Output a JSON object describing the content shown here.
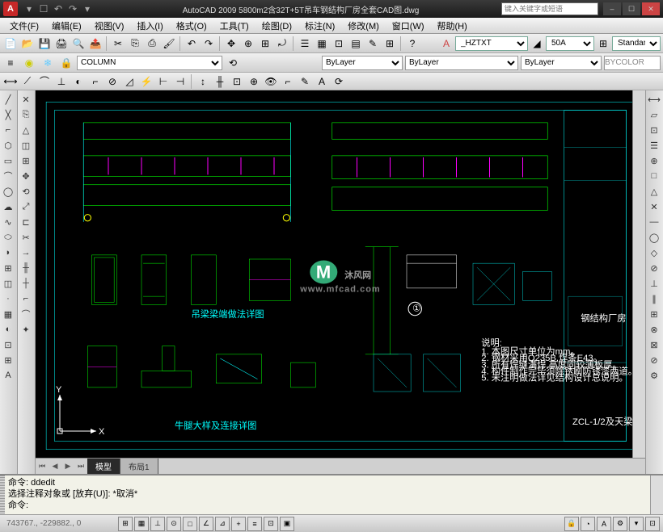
{
  "app": {
    "name": "AutoCAD 2009",
    "title": "AutoCAD 2009  5800m2含32T+5T吊车钢结构厂房全套CAD图.dwg",
    "search_placeholder": "键入关键字或短语",
    "logo": "A"
  },
  "winbtns": {
    "min": "–",
    "max": "☐",
    "close": "✕"
  },
  "qat": [
    "▾",
    "☐",
    "↶",
    "↷",
    "▾"
  ],
  "menubar": [
    "文件(F)",
    "编辑(E)",
    "视图(V)",
    "插入(I)",
    "格式(O)",
    "工具(T)",
    "绘图(D)",
    "标注(N)",
    "修改(M)",
    "窗口(W)",
    "帮助(H)"
  ],
  "toolbar1_icons": [
    "▢",
    "▢",
    "▣",
    "✂",
    "⎘",
    "⎙",
    "↶",
    "↷",
    "⌫",
    "✎",
    "|",
    "✥",
    "⊞",
    "◫",
    "⤢",
    "🔍",
    "⤾",
    "|",
    "◐",
    "◑",
    "◒",
    "◓",
    "◔",
    "◕",
    "⊕",
    "|",
    "▦",
    "▤",
    "⊡",
    "A",
    "?"
  ],
  "style": {
    "textstyle": "_HZTXT",
    "dimstyle": "50A",
    "tablestyle": "Standar"
  },
  "layers": {
    "current": "COLUMN",
    "bylayer1": "ByLayer",
    "bylayer2": "ByLayer",
    "bylayer3": "ByLayer",
    "bycolor": "BYCOLOR",
    "icons": [
      "❄",
      "◉",
      "⊕",
      "◈",
      "⊡"
    ]
  },
  "toolbar3_icons": [
    "⊿",
    "◻",
    "○",
    "⬭",
    "⌓",
    "⊂",
    "∿",
    "⬡",
    "◇",
    "⊞",
    "▦",
    "△",
    "⊥",
    "⊢",
    "✕",
    "◐",
    "◑",
    "⊡",
    "▤",
    "☰",
    "⊟",
    "⊞"
  ],
  "ltool": [
    "╱",
    "╱",
    "⌐",
    "⊓",
    "⊂",
    "◯",
    "⌒",
    "⊃",
    "~",
    "⬭",
    "◇",
    "⊡",
    "⬡",
    "⊞",
    "·",
    "▦",
    "◐",
    "⊕",
    "A",
    "▤"
  ],
  "ltool2": [
    "◉",
    "✂",
    "⎘",
    "△",
    "⊥",
    "⟲",
    "⊡",
    "╫",
    "╪",
    "┼",
    "⊢",
    "⊣",
    "⊤",
    "→",
    "⌐",
    "✕",
    "◫",
    "⊡"
  ],
  "rtool": [
    "⟲",
    "%",
    "⊡",
    "╱",
    "△",
    "⊥",
    "⤡",
    "⊓",
    "⊏",
    "┼",
    "→",
    "—",
    "⌐",
    "⊡",
    "◫",
    "r",
    "⊡",
    "⊘"
  ],
  "tabs": {
    "nav": [
      "⏮",
      "◀",
      "▶",
      "⏭"
    ],
    "items": [
      "模型",
      "布局1"
    ]
  },
  "cmd": {
    "l1": "命令:  ddedit",
    "l2": "选择注释对象或 [放弃(U)]: *取消*",
    "l3": "命令:"
  },
  "status": {
    "coords": "743767., -229882., 0",
    "btns": [
      "⊞",
      "▦",
      "⊥",
      "⊡",
      "⊓",
      "⊡",
      "◫",
      "⊡",
      "▤",
      "⊡",
      "✎"
    ],
    "right": [
      "⊡",
      "◔",
      "⊕",
      "⊖",
      "▾",
      "⊡"
    ]
  },
  "watermark": {
    "main": "沐风网",
    "sub": "www.mfcad.com",
    "logo": "M"
  },
  "ucs": {
    "x": "X",
    "y": "Y"
  }
}
